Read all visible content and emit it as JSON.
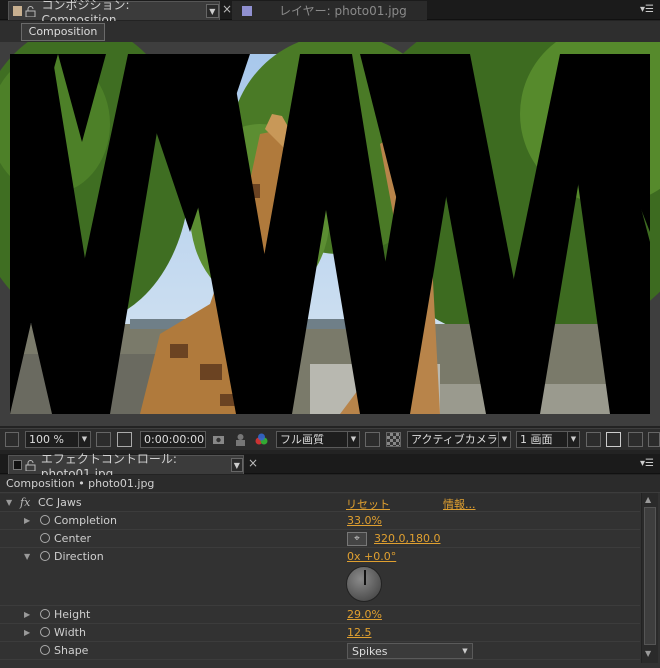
{
  "comp_panel": {
    "tab_active": "コンポジション: Composition",
    "tab_inactive": "レイヤー: photo01.jpg",
    "comp_button": "Composition",
    "menu_icon": "menu-lines-icon"
  },
  "viewer_footer": {
    "zoom": "100 %",
    "timecode": "0:00:00:00",
    "resolution": "フル画質",
    "camera": "アクティブカメラ",
    "views": "1 画面"
  },
  "effect_panel": {
    "tab": "エフェクトコントロール: photo01.jpg",
    "breadcrumb": "Composition • photo01.jpg",
    "effect_name": "CC Jaws",
    "fx_symbol": "fx",
    "reset": "リセット",
    "about": "情報...",
    "properties": [
      {
        "name": "Completion",
        "value": "33.0%"
      },
      {
        "name": "Center",
        "value": "320.0,180.0"
      },
      {
        "name": "Direction",
        "value": "0x +0.0°"
      },
      {
        "name": "Height",
        "value": "29.0%"
      },
      {
        "name": "Width",
        "value": "12.5"
      },
      {
        "name": "Shape",
        "value": "Spikes"
      }
    ]
  },
  "colors": {
    "value_orange": "#e0a030",
    "comp_swatch": "#c8b090",
    "layer_swatch": "#9090d0",
    "background": "#232323"
  }
}
